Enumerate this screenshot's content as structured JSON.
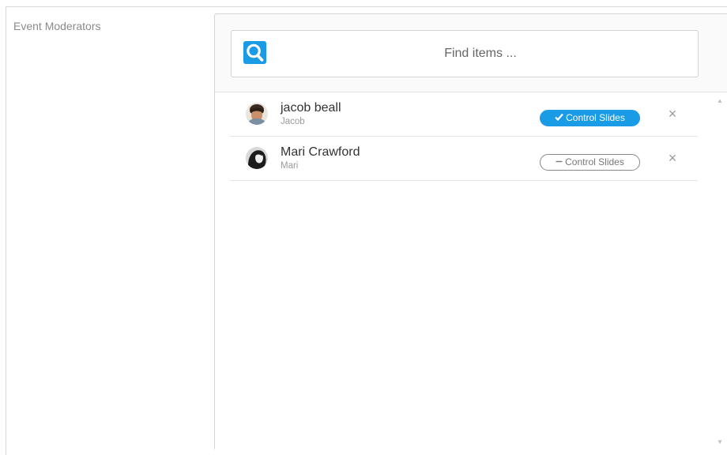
{
  "field": {
    "label": "Event Moderators"
  },
  "search": {
    "placeholder": "Find items ...",
    "value": "",
    "button_icon": "search-icon"
  },
  "moderators": [
    {
      "name": "jacob beall",
      "username": "Jacob",
      "control_label": "Control Slides",
      "control_state": "on",
      "control_icon": "check-icon"
    },
    {
      "name": "Mari Crawford",
      "username": "Mari",
      "control_label": "Control Slides",
      "control_state": "off",
      "control_icon": "minus-icon"
    }
  ],
  "colors": {
    "accent": "#1a9be6",
    "text": "#333333",
    "muted": "#9a9a9a"
  }
}
